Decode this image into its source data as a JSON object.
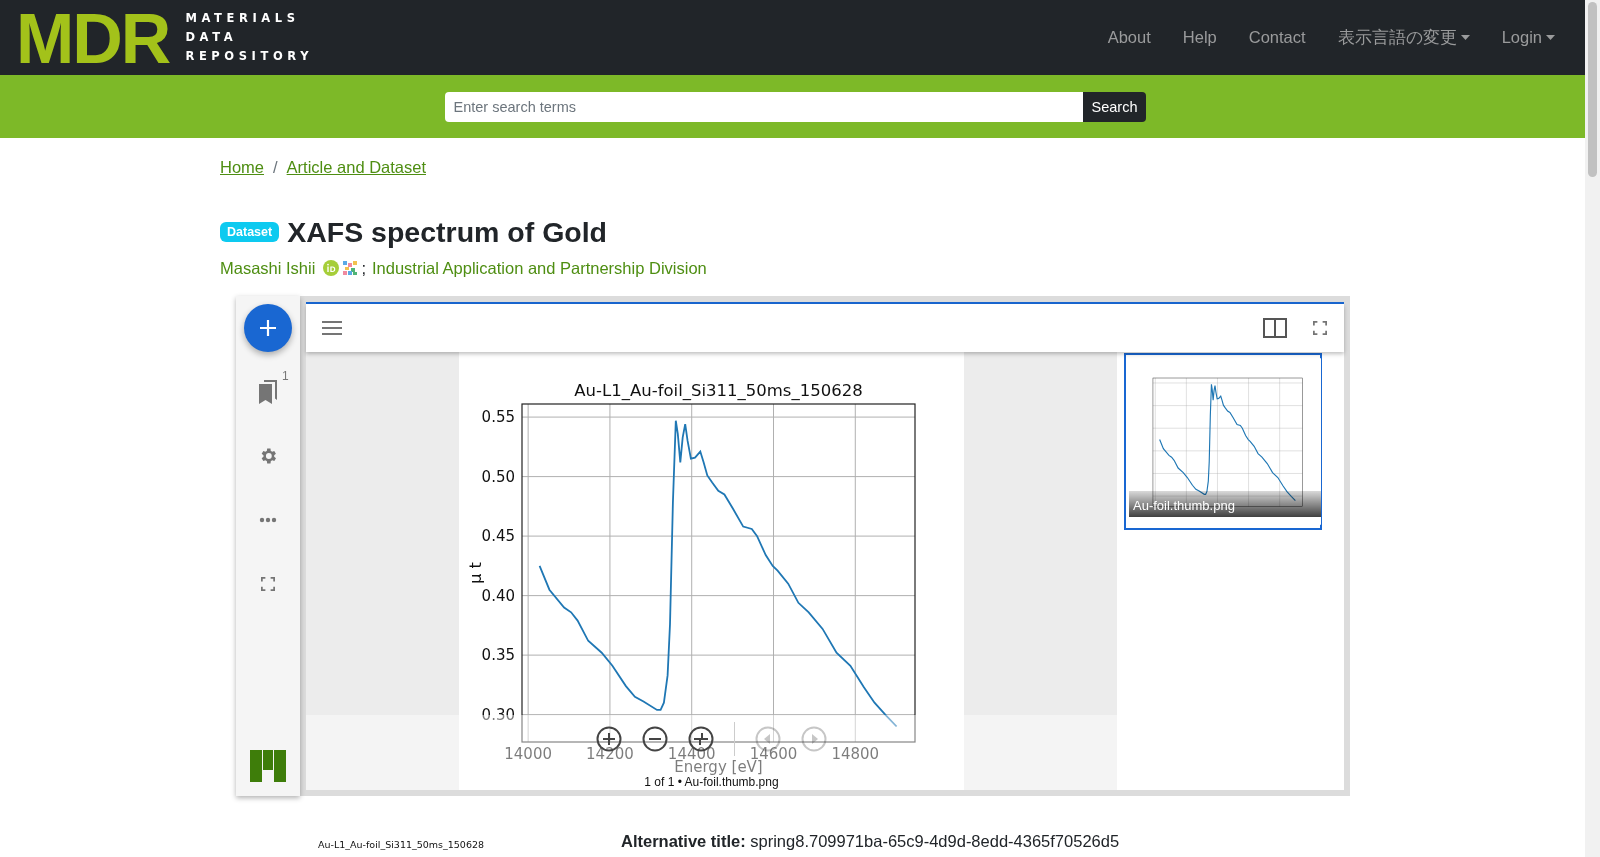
{
  "header": {
    "logo_mark": "MDR",
    "logo_words": [
      "MATERIALS",
      "DATA",
      "REPOSITORY"
    ],
    "nav": [
      {
        "label": "About",
        "dropdown": false
      },
      {
        "label": "Help",
        "dropdown": false
      },
      {
        "label": "Contact",
        "dropdown": false
      },
      {
        "label": "表示言語の変更",
        "dropdown": true
      },
      {
        "label": "Login",
        "dropdown": true
      }
    ]
  },
  "search": {
    "placeholder": "Enter search terms",
    "button": "Search"
  },
  "breadcrumb": {
    "separator": "/",
    "items": [
      "Home",
      "Article and Dataset"
    ]
  },
  "record": {
    "badge": "Dataset",
    "title": "XAFS spectrum of Gold",
    "author": "Masashi Ishii",
    "separator": ";",
    "affiliation": "Industrial Application and Partnership Division"
  },
  "viewer": {
    "index_count": "1",
    "controls": [
      {
        "kind": "zoom-in",
        "disabled": false
      },
      {
        "kind": "zoom-out",
        "disabled": false
      },
      {
        "kind": "reset",
        "disabled": false
      },
      {
        "kind": "previous",
        "disabled": true
      },
      {
        "kind": "next",
        "disabled": true
      }
    ],
    "caption": "1 of 1 • Au-foil.thumb.png",
    "chart_data": {
      "type": "line",
      "title": "Au-L1_Au-foil_Si311_50ms_150628",
      "xlabel": "Energy [eV]",
      "ylabel": "μ t",
      "x": [
        14028,
        14052,
        14088,
        14105,
        14121,
        14147,
        14180,
        14206,
        14239,
        14261,
        14282,
        14315,
        14324,
        14332,
        14341,
        14347,
        14354,
        14361,
        14366,
        14372,
        14378,
        14384,
        14390,
        14398,
        14408,
        14421,
        14429,
        14438,
        14450,
        14465,
        14480,
        14501,
        14526,
        14547,
        14560,
        14581,
        14598,
        14610,
        14636,
        14661,
        14686,
        14720,
        14754,
        14788,
        14821,
        14847,
        14876,
        14901
      ],
      "series": [
        {
          "color": "#1f77b4",
          "values": [
            0.425,
            0.405,
            0.39,
            0.386,
            0.379,
            0.362,
            0.352,
            0.341,
            0.324,
            0.315,
            0.311,
            0.304,
            0.304,
            0.31,
            0.333,
            0.376,
            0.478,
            0.547,
            0.536,
            0.512,
            0.533,
            0.544,
            0.53,
            0.515,
            0.516,
            0.521,
            0.512,
            0.501,
            0.495,
            0.488,
            0.485,
            0.473,
            0.458,
            0.456,
            0.45,
            0.434,
            0.425,
            0.421,
            0.41,
            0.394,
            0.386,
            0.372,
            0.352,
            0.341,
            0.323,
            0.31,
            0.299,
            0.29
          ]
        }
      ],
      "xlim": [
        13985,
        14946
      ],
      "ylim": [
        0.277,
        0.561
      ],
      "grid": true,
      "xticks": [
        14000,
        14200,
        14400,
        14600,
        14800
      ],
      "yticks": [
        {
          "value": 0.3,
          "label": "0.30"
        },
        {
          "value": 0.35,
          "label": "0.35"
        },
        {
          "value": 0.4,
          "label": "0.40"
        },
        {
          "value": 0.45,
          "label": "0.45"
        },
        {
          "value": 0.5,
          "label": "0.50"
        },
        {
          "value": 0.55,
          "label": "0.55"
        }
      ]
    },
    "thumbnail": {
      "selected": true,
      "caption": "Au-foil.thumb.png",
      "kind": "picture"
    }
  },
  "below": {
    "image_title": "Au-L1_Au-foil_Si311_50ms_150628",
    "alternative_title": "**Alternative title:** spring8.709971ba-65c9-4d9d-8edd-4365f70526d5"
  }
}
